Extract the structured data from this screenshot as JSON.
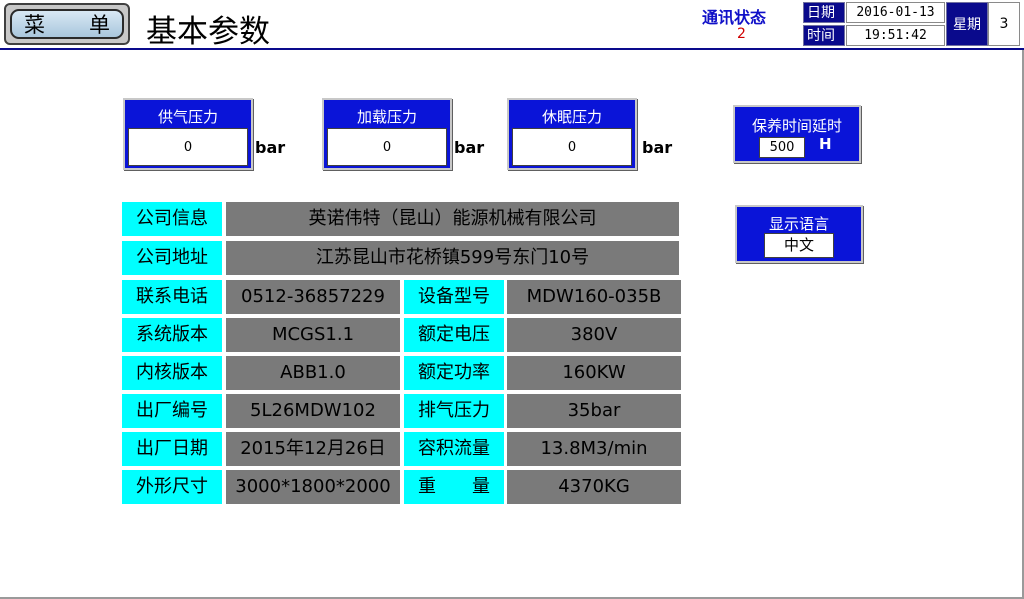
{
  "header": {
    "menu_label_left": "菜",
    "menu_label_right": "单",
    "title": "基本参数",
    "comm_status_label": "通讯状态",
    "comm_status_value": "2",
    "date_label": "日期",
    "date_value": "2016-01-13",
    "time_label": "时间",
    "time_value": "19:51:42",
    "week_label": "星期",
    "week_value": "3"
  },
  "pressures": [
    {
      "label": "供气压力",
      "value": "0",
      "unit": "bar"
    },
    {
      "label": "加载压力",
      "value": "0",
      "unit": "bar"
    },
    {
      "label": "休眠压力",
      "value": "0",
      "unit": "bar"
    }
  ],
  "maintenance": {
    "label": "保养时间延时",
    "value": "500",
    "unit": "H"
  },
  "language": {
    "label": "显示语言",
    "value": "中文"
  },
  "info": {
    "company_info": {
      "label": "公司信息",
      "value": "英诺伟特（昆山）能源机械有限公司"
    },
    "company_address": {
      "label": "公司地址",
      "value": "江苏昆山市花桥镇599号东门10号"
    },
    "rows": [
      {
        "label": "联系电话",
        "value": "0512-36857229",
        "label2": "设备型号",
        "value2": "MDW160-035B"
      },
      {
        "label": "系统版本",
        "value": "MCGS1.1",
        "label2": "额定电压",
        "value2": "380V"
      },
      {
        "label": "内核版本",
        "value": "ABB1.0",
        "label2": "额定功率",
        "value2": "160KW"
      },
      {
        "label": "出厂编号",
        "value": "5L26MDW102",
        "label2": "排气压力",
        "value2": "35bar"
      },
      {
        "label": "出厂日期",
        "value": "2015年12月26日",
        "label2": "容积流量",
        "value2": "13.8M3/min"
      },
      {
        "label": "外形尺寸",
        "value": "3000*1800*2000",
        "label2": "重　　量",
        "value2": "4370KG"
      }
    ]
  },
  "colors": {
    "label_bg": "#00ffff",
    "value_bg": "#7a7a7a",
    "panel_blue": "#0a14d8",
    "header_navy": "#0a0a8c",
    "status_red": "#d00000"
  }
}
